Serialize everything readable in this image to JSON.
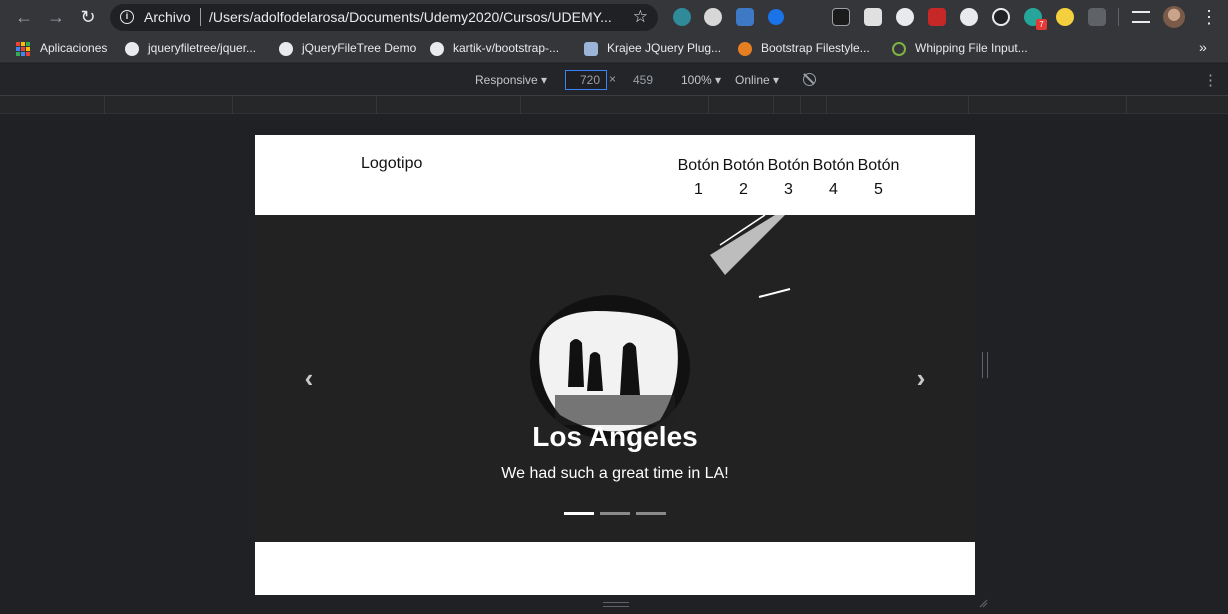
{
  "browser": {
    "omnibox": {
      "scheme_label": "Archivo",
      "url": "/Users/adolfodelarosa/Documents/Udemy2020/Cursos/UDEMY..."
    },
    "extension_badge": "7"
  },
  "bookmarks": [
    {
      "label": "Aplicaciones",
      "icon": "apps-grid-icon"
    },
    {
      "label": "jqueryfiletree/jquer...",
      "icon": "github-icon"
    },
    {
      "label": "jQueryFileTree Demo",
      "icon": "globe-icon"
    },
    {
      "label": "kartik-v/bootstrap-...",
      "icon": "github-icon"
    },
    {
      "label": "Krajee JQuery Plug...",
      "icon": "krajee-icon"
    },
    {
      "label": "Bootstrap Filestyle...",
      "icon": "orange-logo-icon"
    },
    {
      "label": "Whipping File Input...",
      "icon": "leaf-icon"
    }
  ],
  "device_toolbar": {
    "mode": "Responsive ▾",
    "width": "720",
    "times": "×",
    "height": "459",
    "zoom": "100% ▾",
    "network": "Online ▾"
  },
  "page": {
    "logo": "Logotipo",
    "nav_buttons": [
      {
        "word": "Botón",
        "num": "1"
      },
      {
        "word": "Botón",
        "num": "2"
      },
      {
        "word": "Botón",
        "num": "3"
      },
      {
        "word": "Botón",
        "num": "4"
      },
      {
        "word": "Botón",
        "num": "5"
      }
    ],
    "carousel": {
      "title": "Los Angeles",
      "subtitle": "We had such a great time in LA!",
      "prev_glyph": "‹",
      "next_glyph": "›",
      "slide_count": 3,
      "active_slide": 1
    }
  },
  "colors": {
    "chrome_toolbar": "#35363a",
    "devtools_bg": "#202124",
    "carousel_bg": "#222222",
    "accent_input": "#3b82f6"
  }
}
